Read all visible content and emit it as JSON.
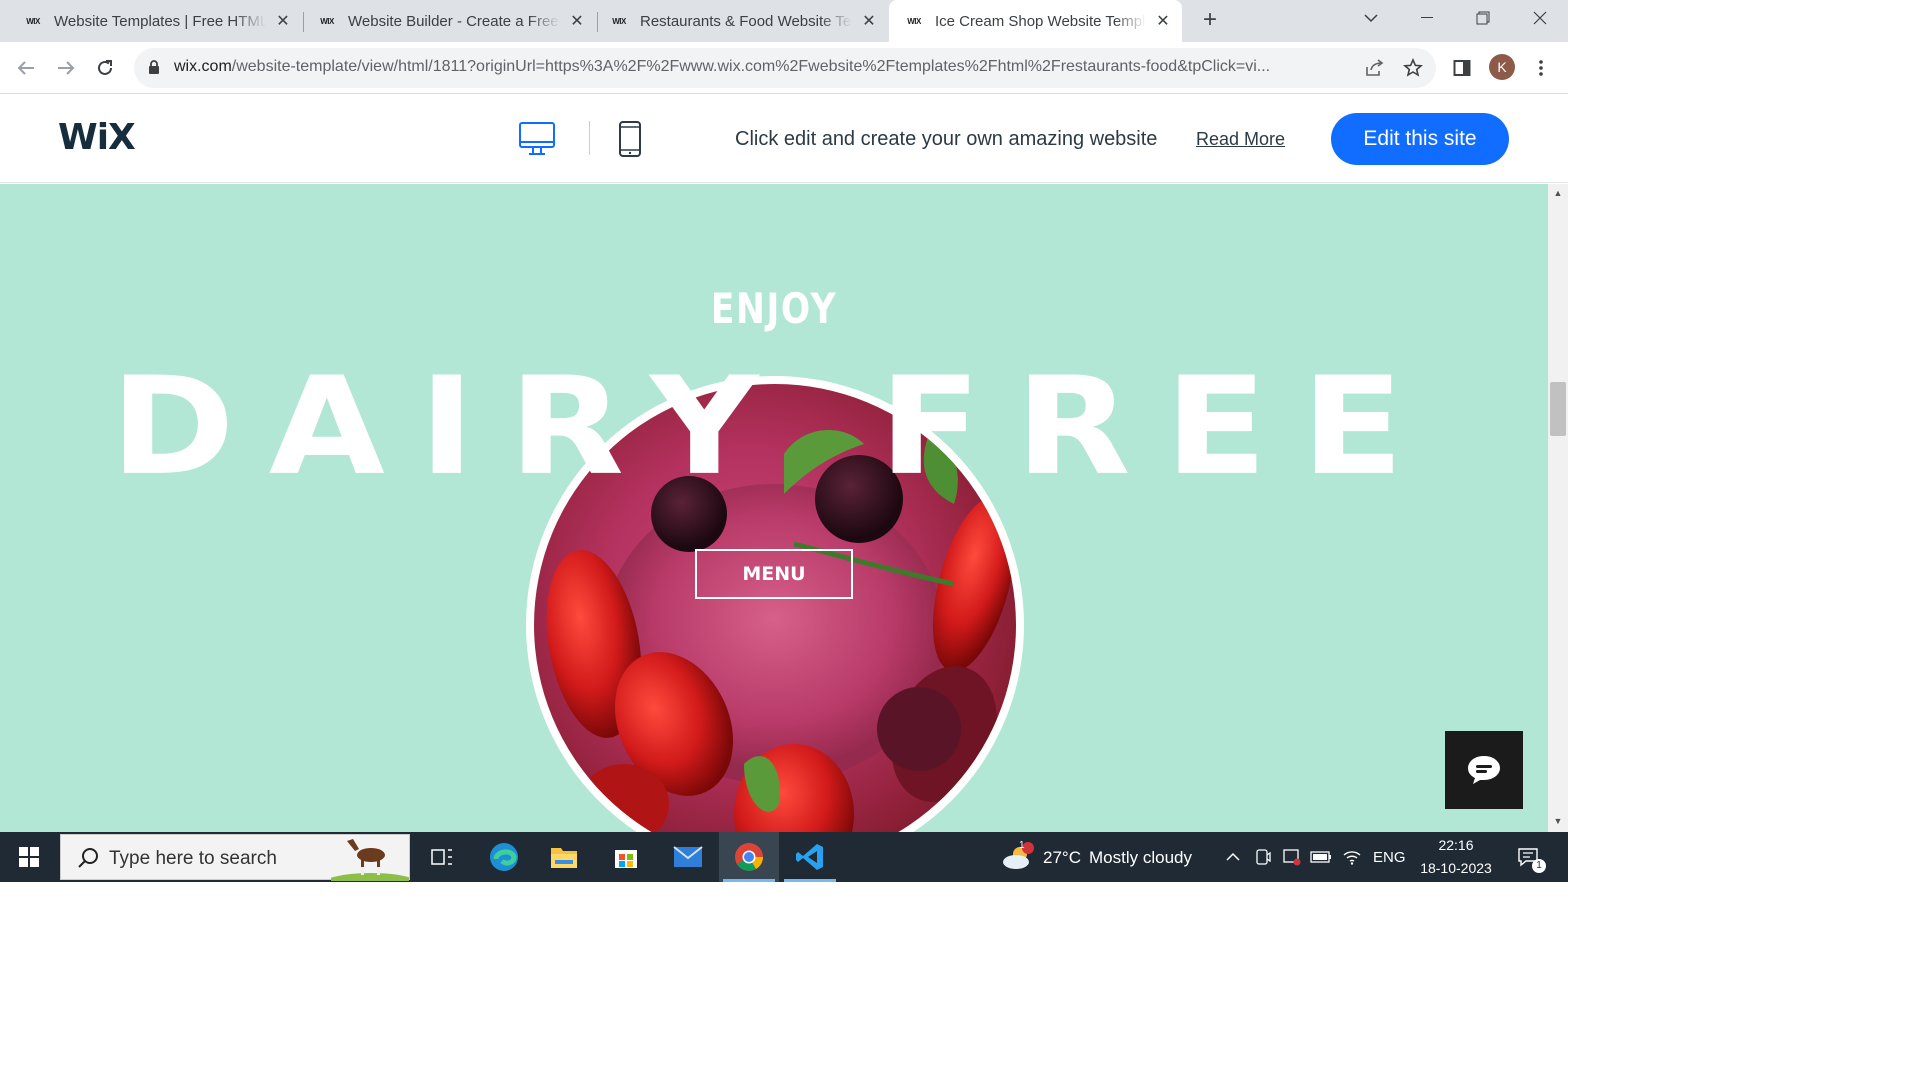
{
  "browser": {
    "tabs": [
      {
        "favicon": "WIX",
        "title": "Website Templates | Free HTML5"
      },
      {
        "favicon": "WIX",
        "title": "Website Builder - Create a Free W"
      },
      {
        "favicon": "WIX",
        "title": "Restaurants & Food Website Tem"
      },
      {
        "favicon": "WIX",
        "title": "Ice Cream Shop Website Templa"
      }
    ],
    "url_host": "wix.com",
    "url_rest": "/website-template/view/html/1811?originUrl=https%3A%2F%2Fwww.wix.com%2Fwebsite%2Ftemplates%2Fhtml%2Frestaurants-food&tpClick=vi...",
    "profile_initial": "K"
  },
  "wix_header": {
    "logo": "WiX",
    "message": "Click edit and create your own amazing website",
    "read_more": "Read More",
    "edit_button": "Edit this site"
  },
  "hero": {
    "kicker": "ENJOY",
    "headline": "DAIRY FREE",
    "menu_button": "MENU",
    "background_color": "#b3e7d5"
  },
  "taskbar": {
    "search_placeholder": "Type here to search",
    "weather_temp": "27°C",
    "weather_desc": "Mostly cloudy",
    "weather_badge": "1",
    "language": "ENG",
    "time": "22:16",
    "date": "18-10-2023",
    "notification_count": "1"
  }
}
